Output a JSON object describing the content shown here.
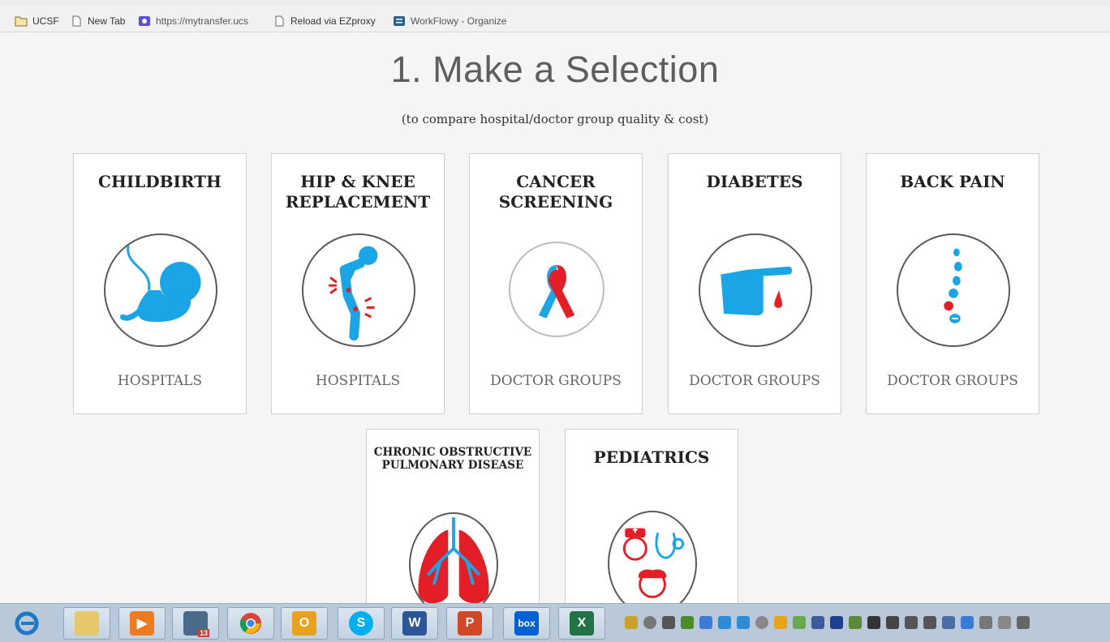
{
  "bookmarks": [
    {
      "label": "UCSF",
      "icon": "folder-icon"
    },
    {
      "label": "New Tab",
      "icon": "page-icon"
    },
    {
      "label": "https://mytransfer.ucs",
      "icon": "transfer-icon"
    },
    {
      "label": "Reload via EZproxy",
      "icon": "page-icon"
    },
    {
      "label": "WorkFlowy - Organize",
      "icon": "workflowy-icon"
    }
  ],
  "page": {
    "title": "1. Make a Selection",
    "subtitle": "(to compare hospital/doctor group quality & cost)"
  },
  "cards": [
    {
      "title": "CHILDBIRTH",
      "subtitle": "HOSPITALS",
      "icon": "fetus-icon"
    },
    {
      "title": "HIP & KNEE REPLACEMENT",
      "subtitle": "HOSPITALS",
      "icon": "joint-pain-icon"
    },
    {
      "title": "CANCER SCREENING",
      "subtitle": "DOCTOR GROUPS",
      "icon": "awareness-ribbon-icon"
    },
    {
      "title": "DIABETES",
      "subtitle": "DOCTOR GROUPS",
      "icon": "finger-blood-drop-icon"
    },
    {
      "title": "BACK PAIN",
      "subtitle": "DOCTOR GROUPS",
      "icon": "spine-icon"
    },
    {
      "title": "CHRONIC OBSTRUCTIVE PULMONARY DISEASE",
      "subtitle": "",
      "icon": "lungs-icon"
    },
    {
      "title": "PEDIATRICS",
      "subtitle": "",
      "icon": "pediatric-doctor-icon"
    }
  ],
  "taskbar": {
    "apps": [
      "internet-explorer-icon",
      "file-explorer-icon",
      "media-player-icon",
      "calendar-icon",
      "chrome-icon",
      "outlook-icon",
      "skype-icon",
      "word-icon",
      "powerpoint-icon",
      "box-icon",
      "excel-icon"
    ],
    "calendar_badge": "13",
    "box_label": "box"
  },
  "colors": {
    "accent_blue": "#1aa6e6",
    "accent_red": "#e31e26",
    "background": "#f5f5f5"
  }
}
